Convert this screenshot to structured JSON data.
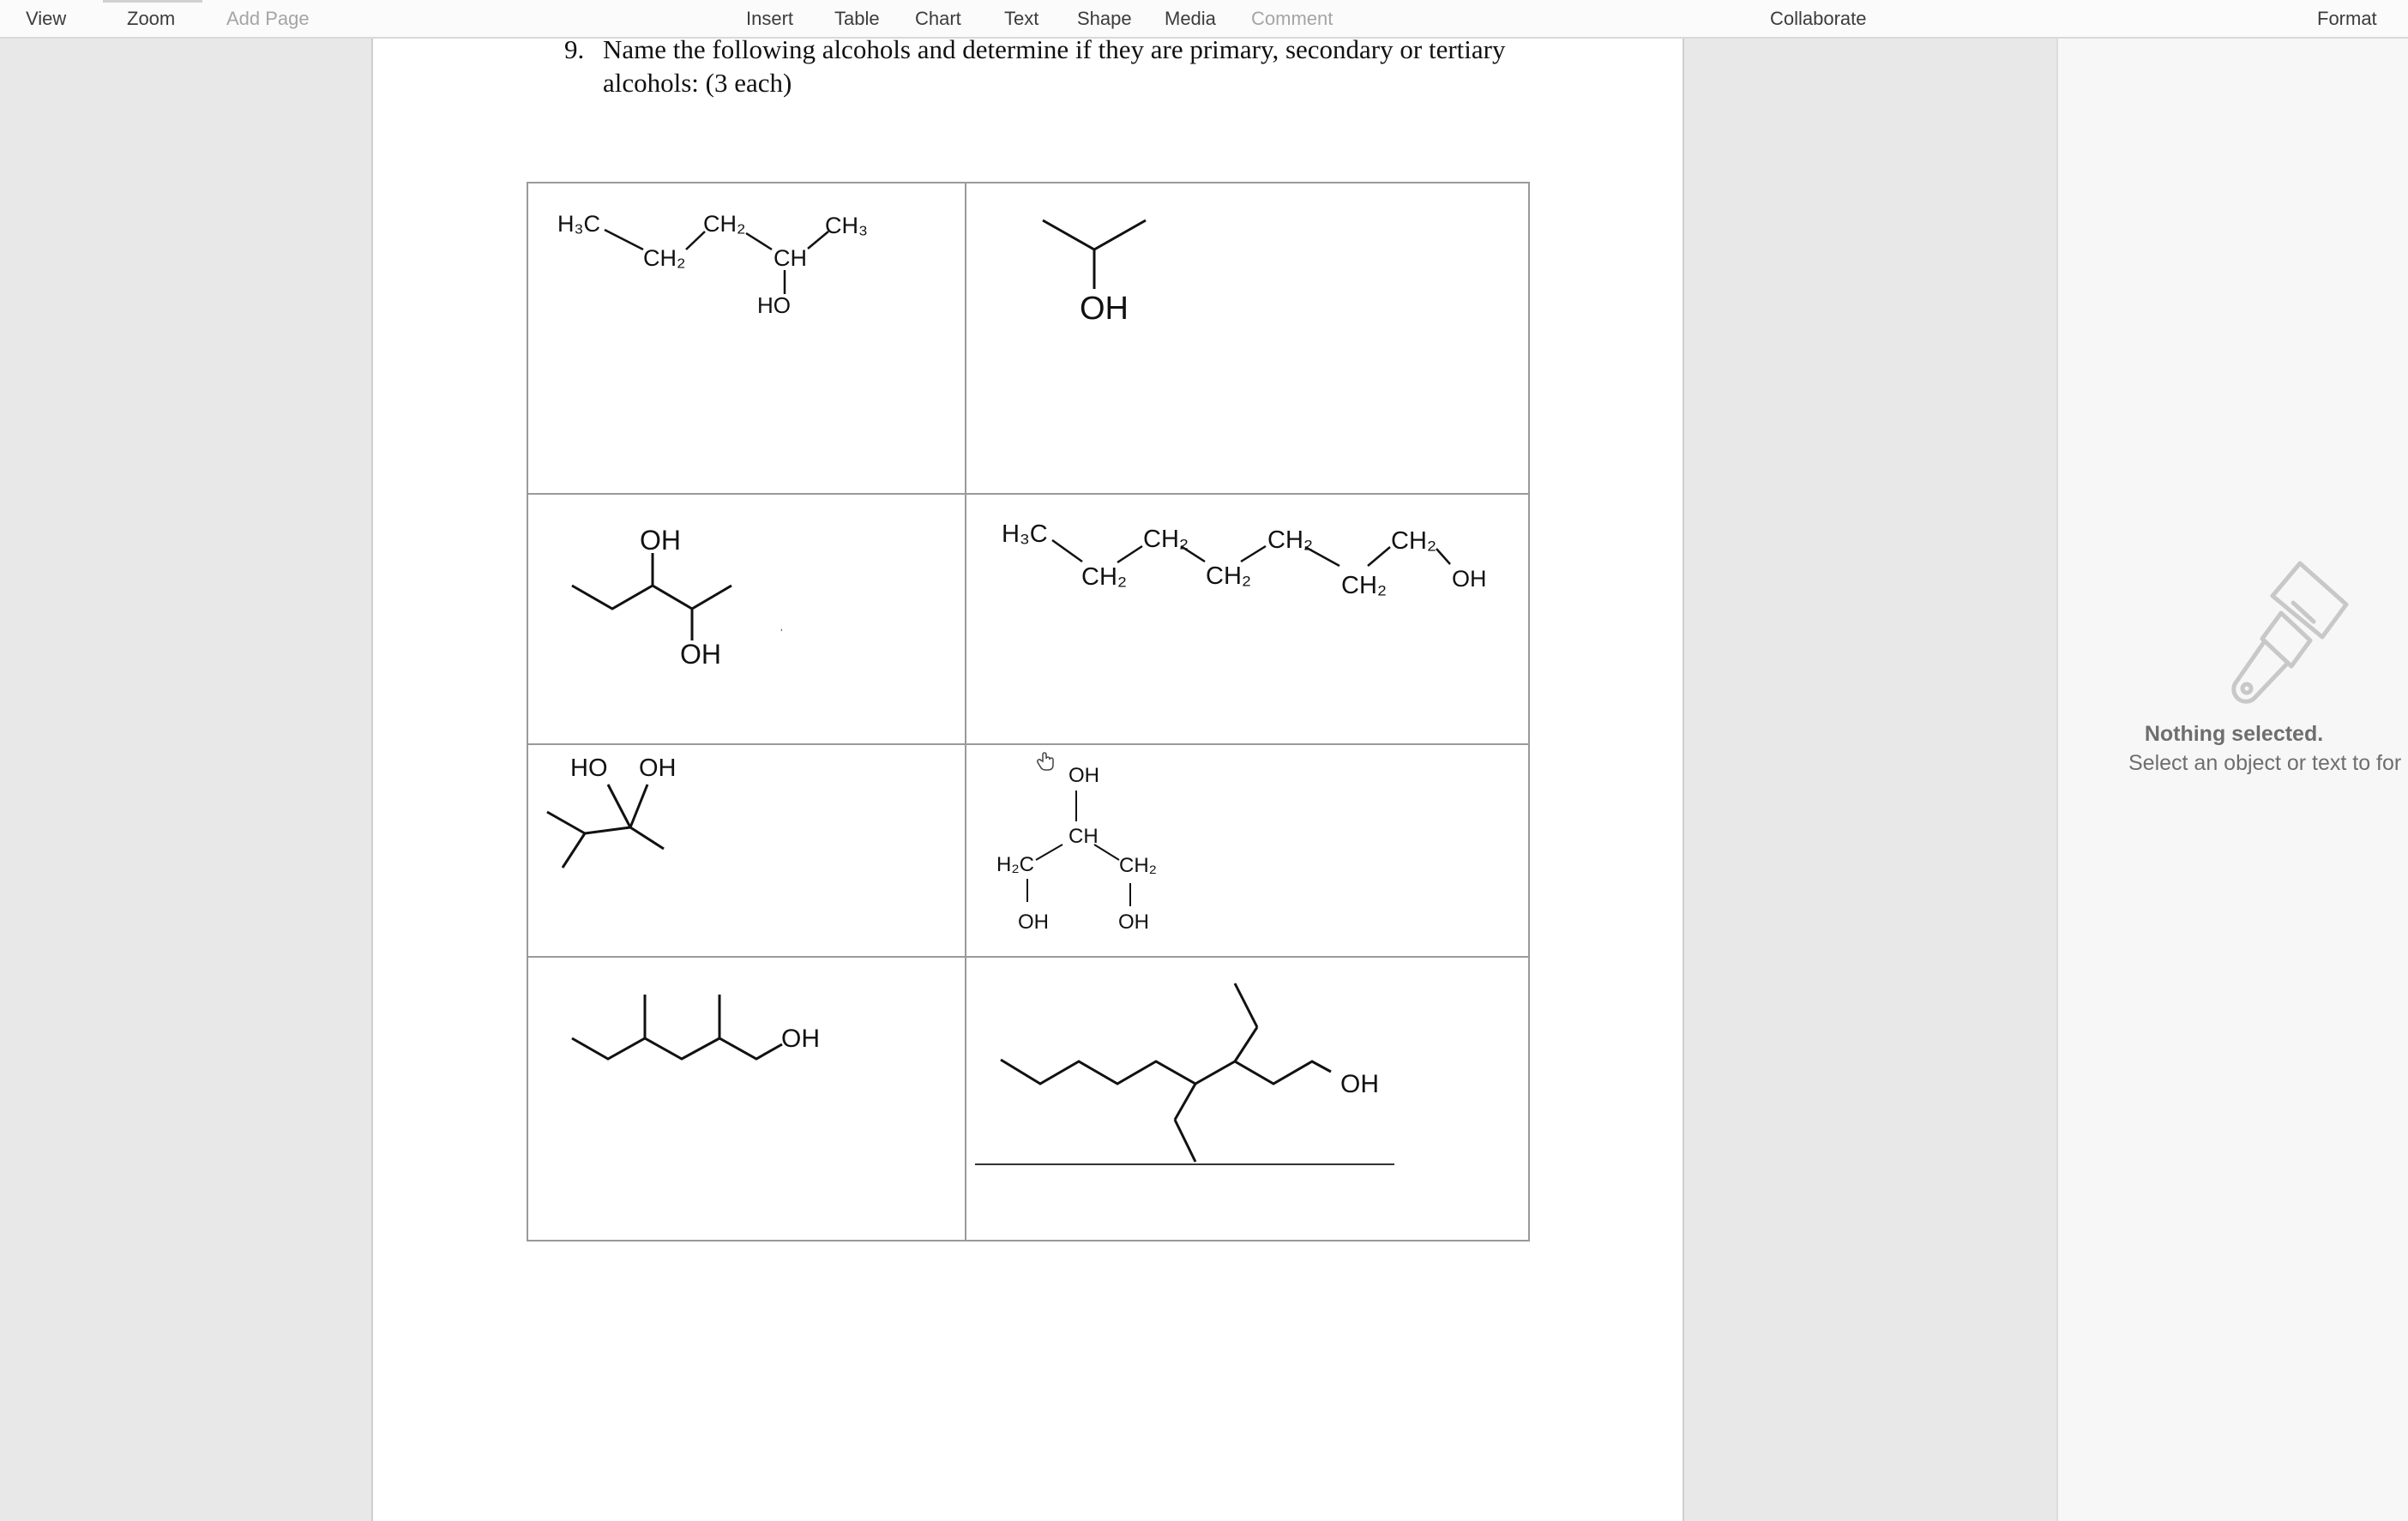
{
  "toolbar": {
    "view": "View",
    "zoom": "Zoom",
    "add_page": "Add Page",
    "insert": "Insert",
    "table": "Table",
    "chart": "Chart",
    "text": "Text",
    "shape": "Shape",
    "media": "Media",
    "comment": "Comment",
    "collaborate": "Collaborate",
    "format": "Format"
  },
  "document": {
    "question_number": "9.",
    "question_text": "Name the following alcohols and determine if they are primary, secondary or tertiary alcohols: (3 each)",
    "structures": {
      "s1": {
        "h3c": "H₃C",
        "ch2": "CH₂",
        "ch2b": "CH₂",
        "ch": "CH",
        "ch3": "CH₃",
        "ho": "HO"
      },
      "s2": {
        "oh": "OH"
      },
      "s3": {
        "oh_top": "OH",
        "oh_bottom": "OH"
      },
      "s4": {
        "h3c": "H₃C",
        "ch2_1": "CH₂",
        "ch2_2": "CH₂",
        "ch2_3": "CH₂",
        "ch2_4": "CH₂",
        "ch2_5": "CH₂",
        "ch2_6": "CH₂",
        "oh": "OH"
      },
      "s5": {
        "ho": "HO",
        "oh": "OH"
      },
      "s6": {
        "oh_top": "OH",
        "ch": "CH",
        "h2c": "H₂C",
        "ch2": "CH₂",
        "oh_left": "OH",
        "oh_right": "OH"
      },
      "s7": {
        "oh": "OH"
      },
      "s8": {
        "oh": "OH"
      }
    }
  },
  "inspector": {
    "title": "Nothing selected.",
    "hint": "Select an object or text to for"
  },
  "icons": {
    "inspector": "paintbrush-icon",
    "cursor": "hand-cursor-icon"
  },
  "colors": {
    "toolbar_bg": "#fbfbfb",
    "canvas_bg": "#e8e8e8",
    "page_bg": "#ffffff",
    "grid_line": "#9a9a9a",
    "inspector_text": "#6e6e6e"
  }
}
